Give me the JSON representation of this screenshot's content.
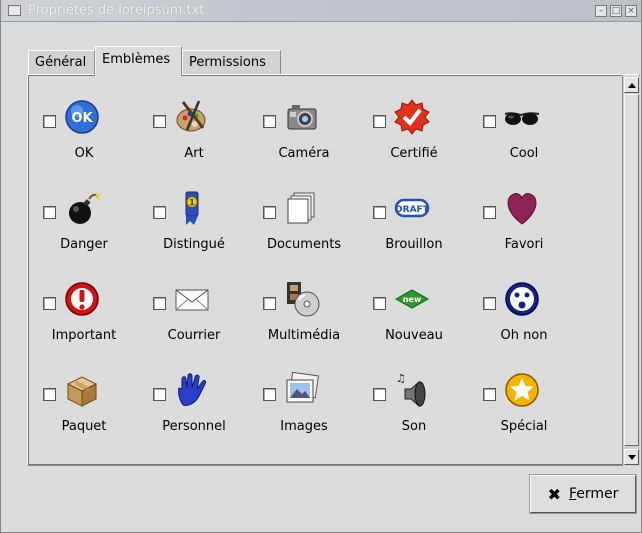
{
  "window": {
    "title": "Propriétés de loreipsum.txt"
  },
  "tabs": [
    {
      "label": "Général",
      "active": false
    },
    {
      "label": "Emblèmes",
      "active": true
    },
    {
      "label": "Permissions",
      "active": false
    }
  ],
  "emblems": [
    {
      "label": "OK",
      "icon": "ok-icon",
      "checked": false
    },
    {
      "label": "Art",
      "icon": "palette-icon",
      "checked": false
    },
    {
      "label": "Caméra",
      "icon": "camera-icon",
      "checked": false
    },
    {
      "label": "Certifié",
      "icon": "certified-icon",
      "checked": false
    },
    {
      "label": "Cool",
      "icon": "sunglasses-icon",
      "checked": false
    },
    {
      "label": "Danger",
      "icon": "bomb-icon",
      "checked": false
    },
    {
      "label": "Distingué",
      "icon": "ribbon-icon",
      "checked": false
    },
    {
      "label": "Documents",
      "icon": "documents-icon",
      "checked": false
    },
    {
      "label": "Brouillon",
      "icon": "draft-icon",
      "checked": false
    },
    {
      "label": "Favori",
      "icon": "heart-icon",
      "checked": false
    },
    {
      "label": "Important",
      "icon": "exclamation-icon",
      "checked": false
    },
    {
      "label": "Courrier",
      "icon": "envelope-icon",
      "checked": false
    },
    {
      "label": "Multimédia",
      "icon": "multimedia-icon",
      "checked": false
    },
    {
      "label": "Nouveau",
      "icon": "new-icon",
      "checked": false
    },
    {
      "label": "Oh non",
      "icon": "oh-no-icon",
      "checked": false
    },
    {
      "label": "Paquet",
      "icon": "package-icon",
      "checked": false
    },
    {
      "label": "Personnel",
      "icon": "hand-icon",
      "checked": false
    },
    {
      "label": "Images",
      "icon": "pictures-icon",
      "checked": false
    },
    {
      "label": "Son",
      "icon": "speaker-icon",
      "checked": false
    },
    {
      "label": "Spécial",
      "icon": "star-icon",
      "checked": false
    }
  ],
  "draft_text": "DRAFT",
  "new_text": "new",
  "close_button": {
    "icon": "close-icon",
    "mnemonic": "F",
    "rest": "ermer"
  }
}
